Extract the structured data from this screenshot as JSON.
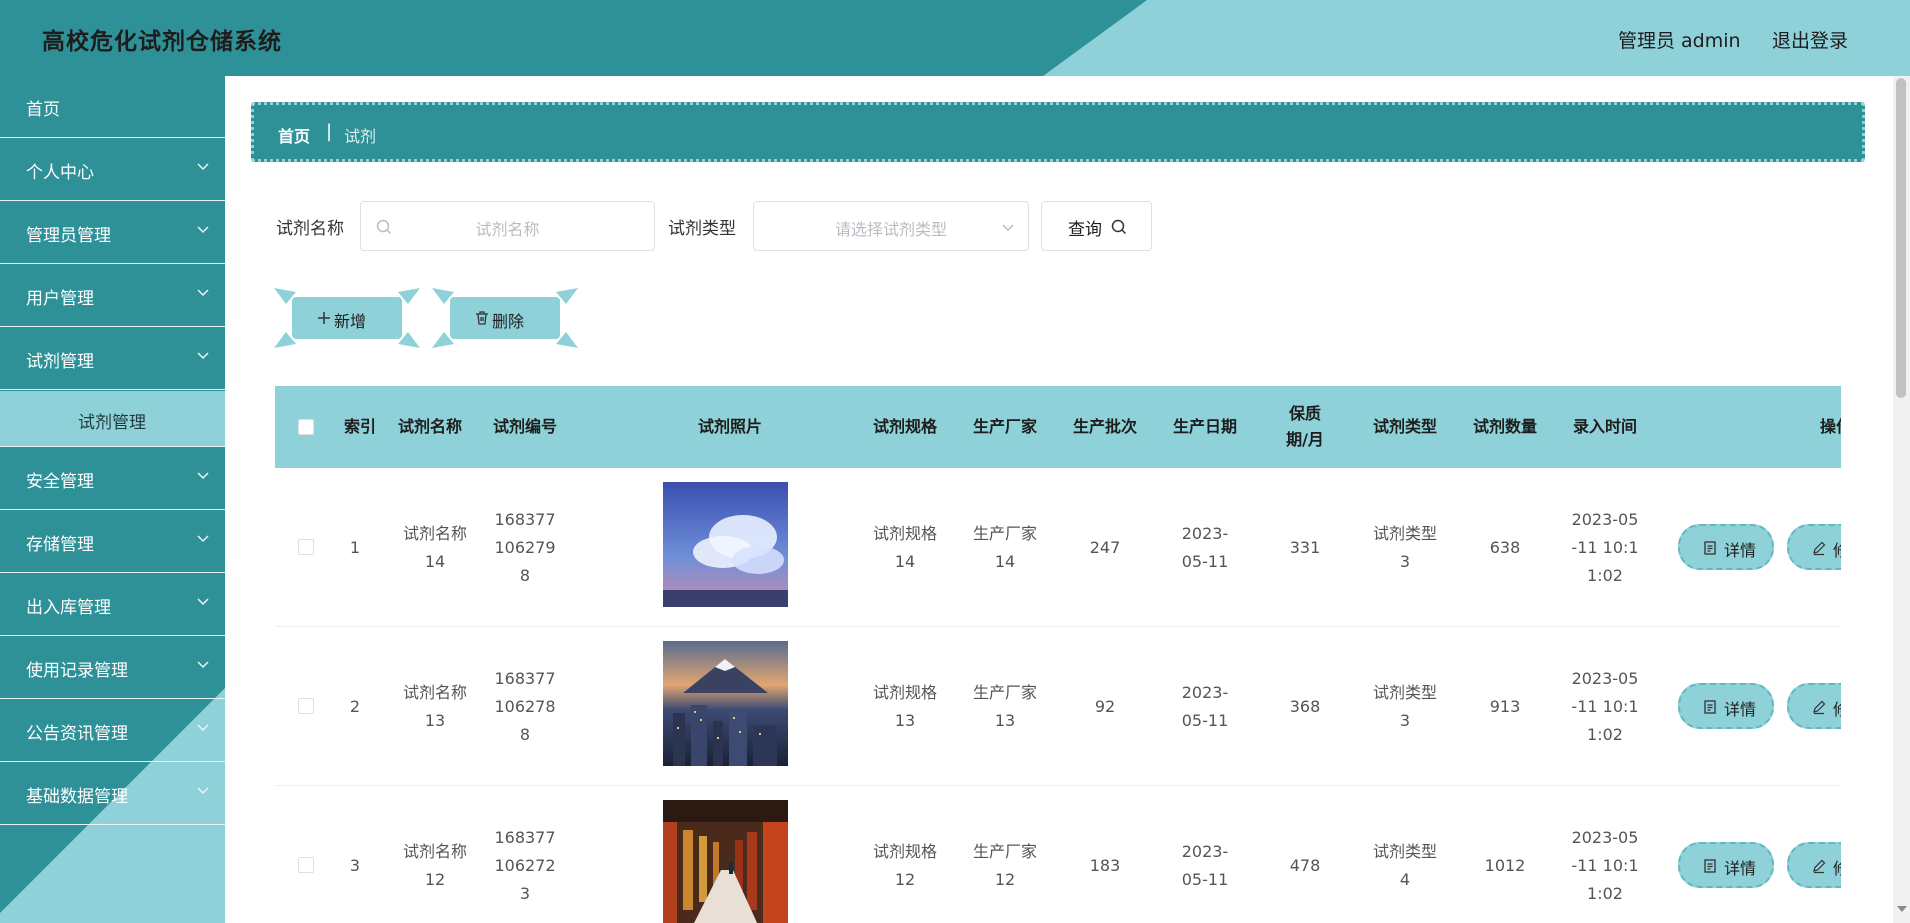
{
  "app": {
    "title": "高校危化试剂仓储系统",
    "user_label": "管理员 admin",
    "logout_label": "退出登录"
  },
  "sidebar": {
    "items": [
      {
        "label": "首页"
      },
      {
        "label": "个人中心"
      },
      {
        "label": "管理员管理"
      },
      {
        "label": "用户管理"
      },
      {
        "label": "试剂管理"
      },
      {
        "label": "安全管理"
      },
      {
        "label": "存储管理"
      },
      {
        "label": "出入库管理"
      },
      {
        "label": "使用记录管理"
      },
      {
        "label": "公告资讯管理"
      },
      {
        "label": "基础数据管理"
      }
    ],
    "active_sub": "试剂管理"
  },
  "breadcrumb": {
    "home": "首页",
    "separator": "|",
    "current": "试剂"
  },
  "search": {
    "name_label": "试剂名称",
    "name_placeholder": "试剂名称",
    "type_label": "试剂类型",
    "type_placeholder": "请选择试剂类型",
    "query_label": "查询"
  },
  "actions": {
    "add_label": "新增",
    "delete_label": "删除"
  },
  "table": {
    "headers": [
      "索引",
      "试剂名称",
      "试剂编号",
      "试剂照片",
      "试剂规格",
      "生产厂家",
      "生产批次",
      "生产日期",
      "保质期/月",
      "试剂类型",
      "试剂数量",
      "录入时间",
      "操作"
    ],
    "rows": [
      {
        "index": "1",
        "name": "试剂名称14",
        "code": "1683771062798",
        "photo": "sky-clouds",
        "spec": "试剂规格14",
        "maker": "生产厂家14",
        "batch": "247",
        "date": "2023-05-11",
        "shelf": "331",
        "type": "试剂类型3",
        "qty": "638",
        "time": "2023-05-11 10:11:02"
      },
      {
        "index": "2",
        "name": "试剂名称13",
        "code": "1683771062788",
        "photo": "mountain-city",
        "spec": "试剂规格13",
        "maker": "生产厂家13",
        "batch": "92",
        "date": "2023-05-11",
        "shelf": "368",
        "type": "试剂类型3",
        "qty": "913",
        "time": "2023-05-11 10:11:02"
      },
      {
        "index": "3",
        "name": "试剂名称12",
        "code": "1683771062723",
        "photo": "temple-corridor",
        "spec": "试剂规格12",
        "maker": "生产厂家12",
        "batch": "183",
        "date": "2023-05-11",
        "shelf": "478",
        "type": "试剂类型4",
        "qty": "1012",
        "time": "2023-05-11 10:11:02"
      }
    ],
    "row_buttons": {
      "detail": "详情",
      "edit": "修"
    }
  },
  "colors": {
    "primary": "#2f9198",
    "accent": "#8fd1d8"
  }
}
